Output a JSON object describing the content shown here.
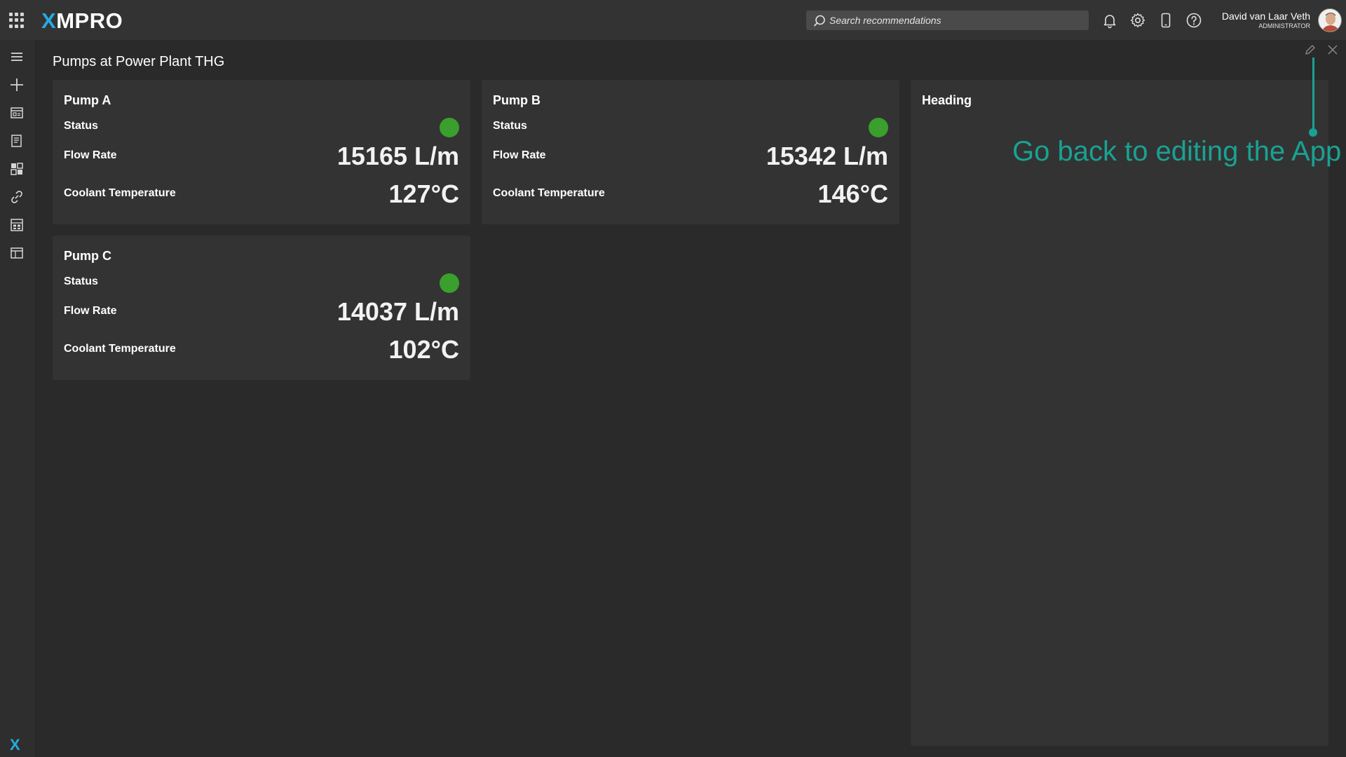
{
  "header": {
    "logo_prefix": "X",
    "logo_rest": "MPRO",
    "search_placeholder": "Search recommendations",
    "user_name": "David van Laar Veth",
    "user_role": "ADMINISTRATOR"
  },
  "page": {
    "title": "Pumps at Power Plant THG"
  },
  "labels": {
    "status": "Status",
    "flow_rate": "Flow Rate",
    "coolant_temperature": "Coolant Temperature"
  },
  "pumps": [
    {
      "name": "Pump A",
      "flow_rate": "15165 L/m",
      "coolant_temperature": "127°C",
      "status_color": "#3a9f2c"
    },
    {
      "name": "Pump B",
      "flow_rate": "15342 L/m",
      "coolant_temperature": "146°C",
      "status_color": "#3a9f2c"
    },
    {
      "name": "Pump C",
      "flow_rate": "14037 L/m",
      "coolant_temperature": "102°C",
      "status_color": "#3a9f2c"
    }
  ],
  "heading_card": {
    "title": "Heading"
  },
  "tooltip": {
    "text": "Go back to editing the App",
    "color": "#1aa193"
  },
  "colors": {
    "accent": "#27a9e1",
    "status_ok": "#3a9f2c"
  },
  "icons": {
    "sidebar": [
      "menu-icon",
      "add-icon",
      "app-icon",
      "recommendation-icon",
      "dashboard-icon",
      "link-icon",
      "grid-icon",
      "window-icon"
    ],
    "topbar": [
      "bell-icon",
      "gear-icon",
      "mobile-icon",
      "help-icon"
    ]
  }
}
